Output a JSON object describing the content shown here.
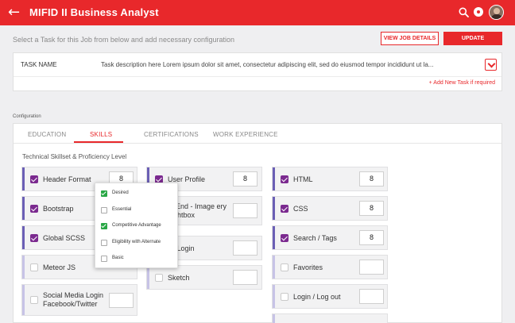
{
  "header": {
    "back_icon": "←",
    "title": "MIFID II Business Analyst",
    "accent_color": "#e8282b"
  },
  "subtitle": "Select a Task for this Job from below and add necessary configuration",
  "buttons": {
    "view_job_details": "VIEW JOB DETAILS",
    "update": "UPDATE"
  },
  "task": {
    "label": "TASK NAME",
    "description": "Task description here Lorem ipsum dolor sit amet, consectetur adipiscing elit, sed do eiusmod tempor incididunt ut la...",
    "add_link": "+ Add New Task if required"
  },
  "configuration": {
    "label": "Configuration",
    "tabs": [
      {
        "label": "EDUCATION",
        "active": false
      },
      {
        "label": "SKILLS",
        "active": true
      },
      {
        "label": "CERTIFICATIONS",
        "active": false
      },
      {
        "label": "WORK EXPERIENCE",
        "active": false
      }
    ],
    "skills_heading": "Technical Skillset & Proficiency Level"
  },
  "skills": [
    {
      "name": "Header Format",
      "checked": true,
      "level": "8"
    },
    {
      "name": "Bootstrap",
      "checked": true,
      "level": ""
    },
    {
      "name": "Global SCSS",
      "checked": true,
      "level": ""
    },
    {
      "name": "Meteor JS",
      "checked": false,
      "level": ""
    },
    {
      "name": "Social Media Login Facebook/Twitter",
      "checked": false,
      "level": ""
    },
    {
      "name": "User Profile",
      "checked": true,
      "level": "8"
    },
    {
      "name": "nt End - Image ery Lightbox",
      "checked": true,
      "level": ""
    },
    {
      "name": "ial Login",
      "checked": false,
      "level": ""
    },
    {
      "name": "Sketch",
      "checked": false,
      "level": ""
    },
    {
      "name": "HTML",
      "checked": true,
      "level": "8"
    },
    {
      "name": "CSS",
      "checked": true,
      "level": "8"
    },
    {
      "name": "Search / Tags",
      "checked": true,
      "level": "8"
    },
    {
      "name": "Favorites",
      "checked": false,
      "level": ""
    },
    {
      "name": "Login / Log out",
      "checked": false,
      "level": ""
    }
  ],
  "dropdown": {
    "options": [
      {
        "label": "Desired",
        "checked": true
      },
      {
        "label": "Essential",
        "checked": false
      },
      {
        "label": "Competitive Advantage",
        "checked": true
      },
      {
        "label": "Eligibility with Alternate",
        "checked": false
      },
      {
        "label": "Basic",
        "checked": false
      }
    ]
  }
}
